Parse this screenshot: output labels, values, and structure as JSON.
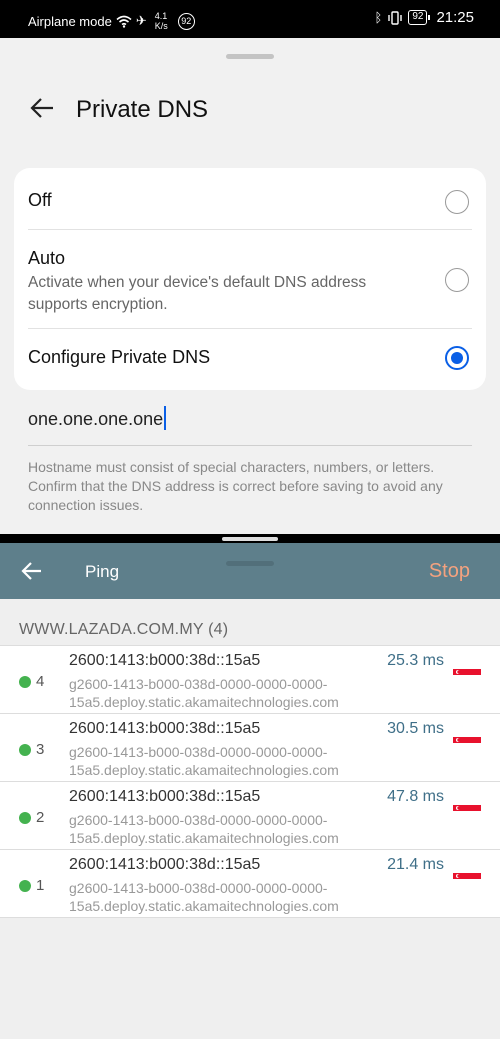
{
  "status_bar": {
    "mode": "Airplane mode",
    "speed_top": "4.1",
    "speed_bottom": "K/s",
    "notif_count": "92",
    "battery": "92",
    "time": "21:25"
  },
  "dns": {
    "title": "Private DNS",
    "options": [
      {
        "label": "Off",
        "desc": "",
        "selected": false
      },
      {
        "label": "Auto",
        "desc": "Activate when your device's default DNS address supports encryption.",
        "selected": false
      },
      {
        "label": "Configure Private DNS",
        "desc": "",
        "selected": true
      }
    ],
    "hostname_value": "one.one.one.one",
    "hint": "Hostname must consist of special characters, numbers, or letters. Confirm that the DNS address is correct before saving to avoid any connection issues."
  },
  "ping": {
    "title": "Ping",
    "stop_label": "Stop",
    "section_header": "WWW.LAZADA.COM.MY (4)",
    "accent": "#5e7f8b",
    "rows": [
      {
        "num": "4",
        "ip": "2600:1413:b000:38d::15a5",
        "ms": "25.3 ms",
        "host": "g2600-1413-b000-038d-0000-0000-0000-15a5.deploy.static.akamaitechnologies.com"
      },
      {
        "num": "3",
        "ip": "2600:1413:b000:38d::15a5",
        "ms": "30.5 ms",
        "host": "g2600-1413-b000-038d-0000-0000-0000-15a5.deploy.static.akamaitechnologies.com"
      },
      {
        "num": "2",
        "ip": "2600:1413:b000:38d::15a5",
        "ms": "47.8 ms",
        "host": "g2600-1413-b000-038d-0000-0000-0000-15a5.deploy.static.akamaitechnologies.com"
      },
      {
        "num": "1",
        "ip": "2600:1413:b000:38d::15a5",
        "ms": "21.4 ms",
        "host": "g2600-1413-b000-038d-0000-0000-0000-15a5.deploy.static.akamaitechnologies.com"
      }
    ]
  }
}
